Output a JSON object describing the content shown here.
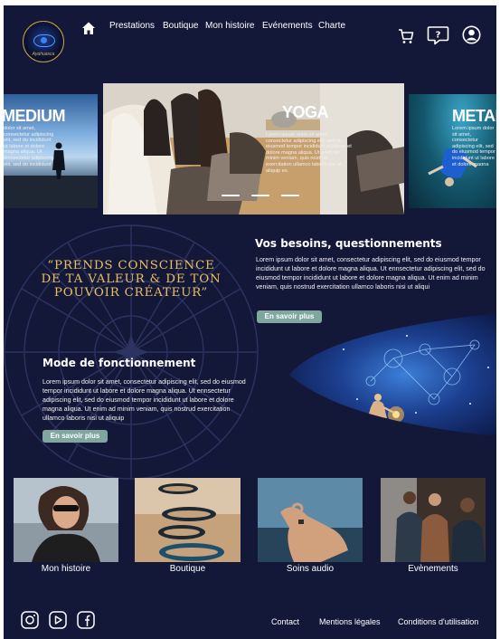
{
  "header": {
    "logo_signature": "Ayahuasca",
    "nav": [
      "Prestations",
      "Boutique",
      "Mon histoire",
      "Evénements",
      "Charte"
    ],
    "icons": [
      "home-icon",
      "cart-icon",
      "question-bubble-icon",
      "account-icon"
    ]
  },
  "carousel": {
    "left": {
      "title": "MEDIUM",
      "text": "dolor sit amet, consectetur adipiscing elit, sed do incididunt ut labore et dolore magna aliqua. Ut ennsectetur adipiscing elit, sed do incididunt ut labore et dolore magna aliqua."
    },
    "center": {
      "title": "YOGA",
      "text": "Lorem ipsum dolor sit amet, consectetur adipiscing elit, sed do eiusmod tempor incididunt ut labore et dolore magna aliqua. Ut enim ad minim veniam, quis nostrud exercitation ullamco laboris nisi ut aliquip ex."
    },
    "right": {
      "title": "METAL",
      "text": "Lorem ipsum dolor sit amet, consectetur adipiscing elit, sed do eiusmod tempor incididunt ut labore et dolore magna aliqua. Ut enim."
    },
    "active_slide": 1,
    "slide_count": 3
  },
  "quote": "“Prends conscience de ta valeur & de ton pouvoir créateur”",
  "besoins": {
    "title": "Vos besoins, questionnements",
    "text": "Lorem ipsum dolor sit amet, consectetur adipiscing elit, sed do eiusmod tempor incididunt ut labore et dolore magna aliqua. Ut ennsectetur adipiscing elit, sed do eiusmod tempor incididunt ut labore et dolore magna aliqua. Ut enim ad minim veniam, quis nostrud exercitation ullamco laboris nisi ut aliqui",
    "button": "En savoir plus"
  },
  "mode": {
    "title": "Mode de fonctionnement",
    "text": "Lorem ipsum dolor sit amet, consectetur adipiscing elit, sed do eiusmod tempor incididunt ut labore et dolore magna aliqua. Ut ennsectetur adipiscing elit, sed do eiusmod tempor incididunt ut labore et dolore magna aliqua. Ut enim ad minim veniam, quis nostrud exercitation ullamco laboris nisi ut aliquip",
    "button": "En savoir plus"
  },
  "tiles": [
    "Mon histoire",
    "Boutique",
    "Soins audio",
    "Evènements"
  ],
  "footer": {
    "social": [
      "instagram-icon",
      "youtube-icon",
      "facebook-icon"
    ],
    "links": [
      "Contact",
      "Mentions légales",
      "Conditions d'utilisation"
    ]
  },
  "colors": {
    "background": "#141838",
    "gold": "#e8be62",
    "button": "#80a79f"
  }
}
